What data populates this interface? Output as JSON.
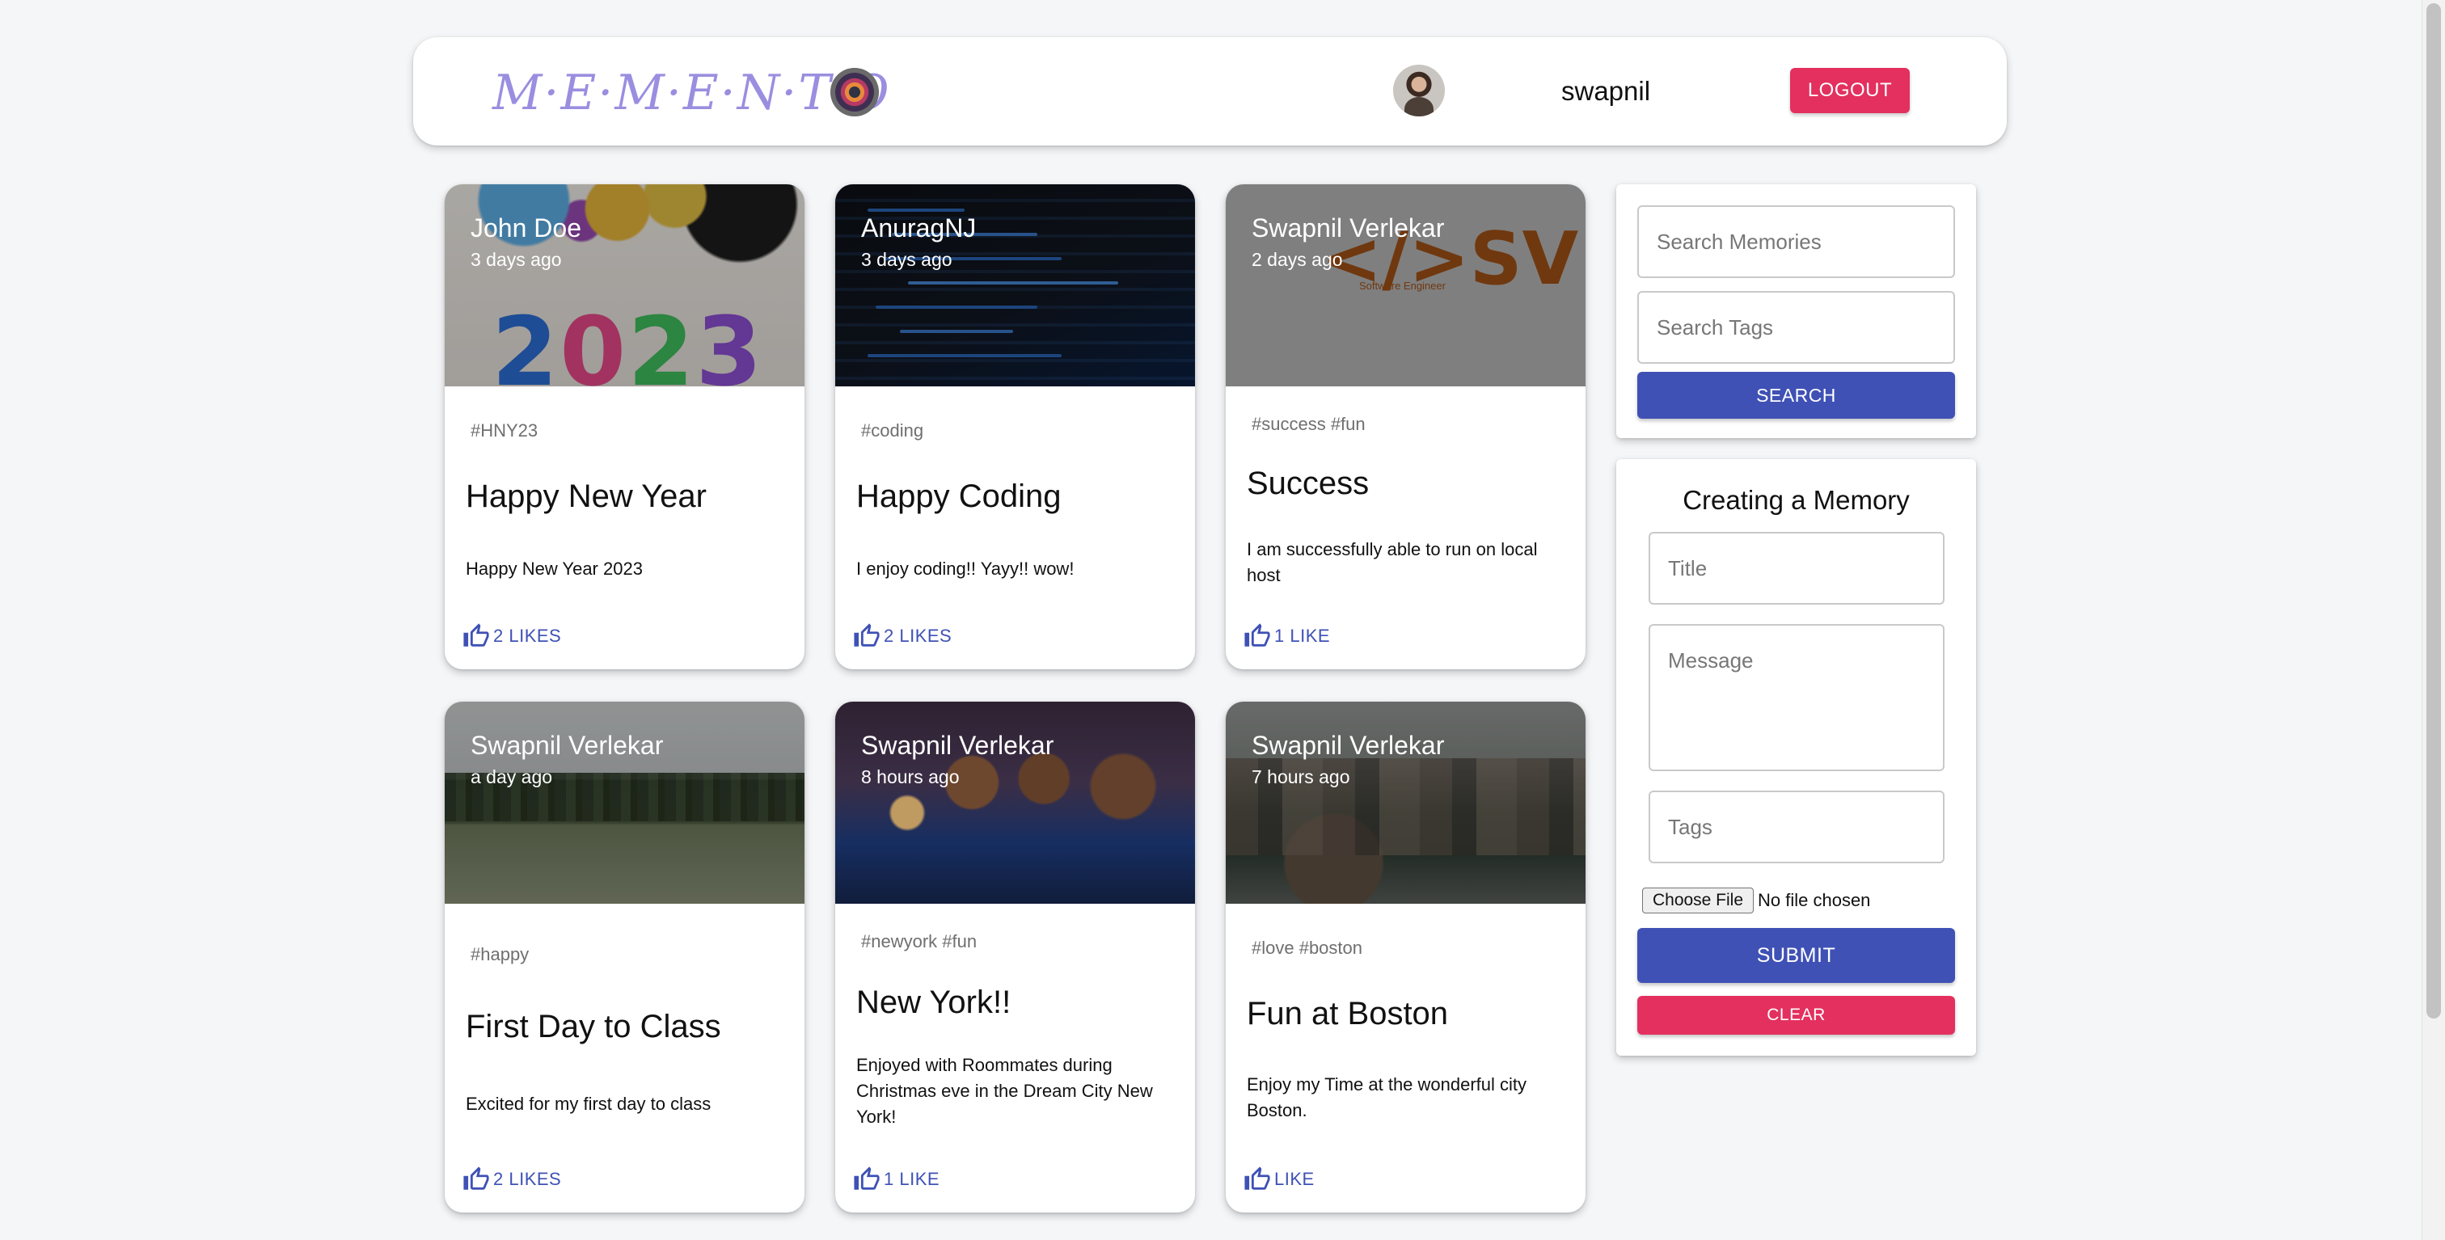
{
  "header": {
    "brand": "M·E·M·E·N·T·O",
    "username": "swapnil",
    "logout_label": "LOGOUT"
  },
  "posts": [
    {
      "author": "John Doe",
      "time": "3 days ago",
      "tags": "#HNY23",
      "title": "Happy New Year",
      "message": "Happy New Year 2023",
      "likes": "2 LIKES",
      "image_text": "2023"
    },
    {
      "author": "AnuragNJ",
      "time": "3 days ago",
      "tags": "#coding",
      "title": "Happy Coding",
      "message": "I enjoy coding!! Yayy!! wow!",
      "likes": "2 LIKES"
    },
    {
      "author": "Swapnil Verlekar",
      "time": "2 days ago",
      "tags": "#success #fun",
      "title": "Success",
      "message": "I am successfully able to run on local host",
      "likes": "1 LIKE",
      "image_text": "</>SV",
      "image_subtext": "Software Engineer"
    },
    {
      "author": "Swapnil Verlekar",
      "time": "a day ago",
      "tags": "#happy",
      "title": "First Day to Class",
      "message": "Excited for my first day to class",
      "likes": "2 LIKES"
    },
    {
      "author": "Swapnil Verlekar",
      "time": "8 hours ago",
      "tags": "#newyork #fun",
      "title": "New York!!",
      "message": "Enjoyed with Roommates during Christmas eve in the Dream City New York!",
      "likes": "1 LIKE"
    },
    {
      "author": "Swapnil Verlekar",
      "time": "7 hours ago",
      "tags": "#love #boston",
      "title": "Fun at Boston",
      "message": "Enjoy my Time at the wonderful city Boston.",
      "likes": "LIKE"
    }
  ],
  "search": {
    "memories_placeholder": "Search Memories",
    "tags_placeholder": "Search Tags",
    "button_label": "SEARCH"
  },
  "form": {
    "heading": "Creating a Memory",
    "title_placeholder": "Title",
    "message_placeholder": "Message",
    "tags_placeholder": "Tags",
    "file_button_label": "Choose File",
    "file_status": "No file chosen",
    "submit_label": "SUBMIT",
    "clear_label": "CLEAR"
  },
  "colors": {
    "primary": "#3f51b5",
    "secondary": "#e3305e",
    "background": "#f5f6f8"
  },
  "icons": {
    "like": "thumb-up-outline-icon"
  }
}
